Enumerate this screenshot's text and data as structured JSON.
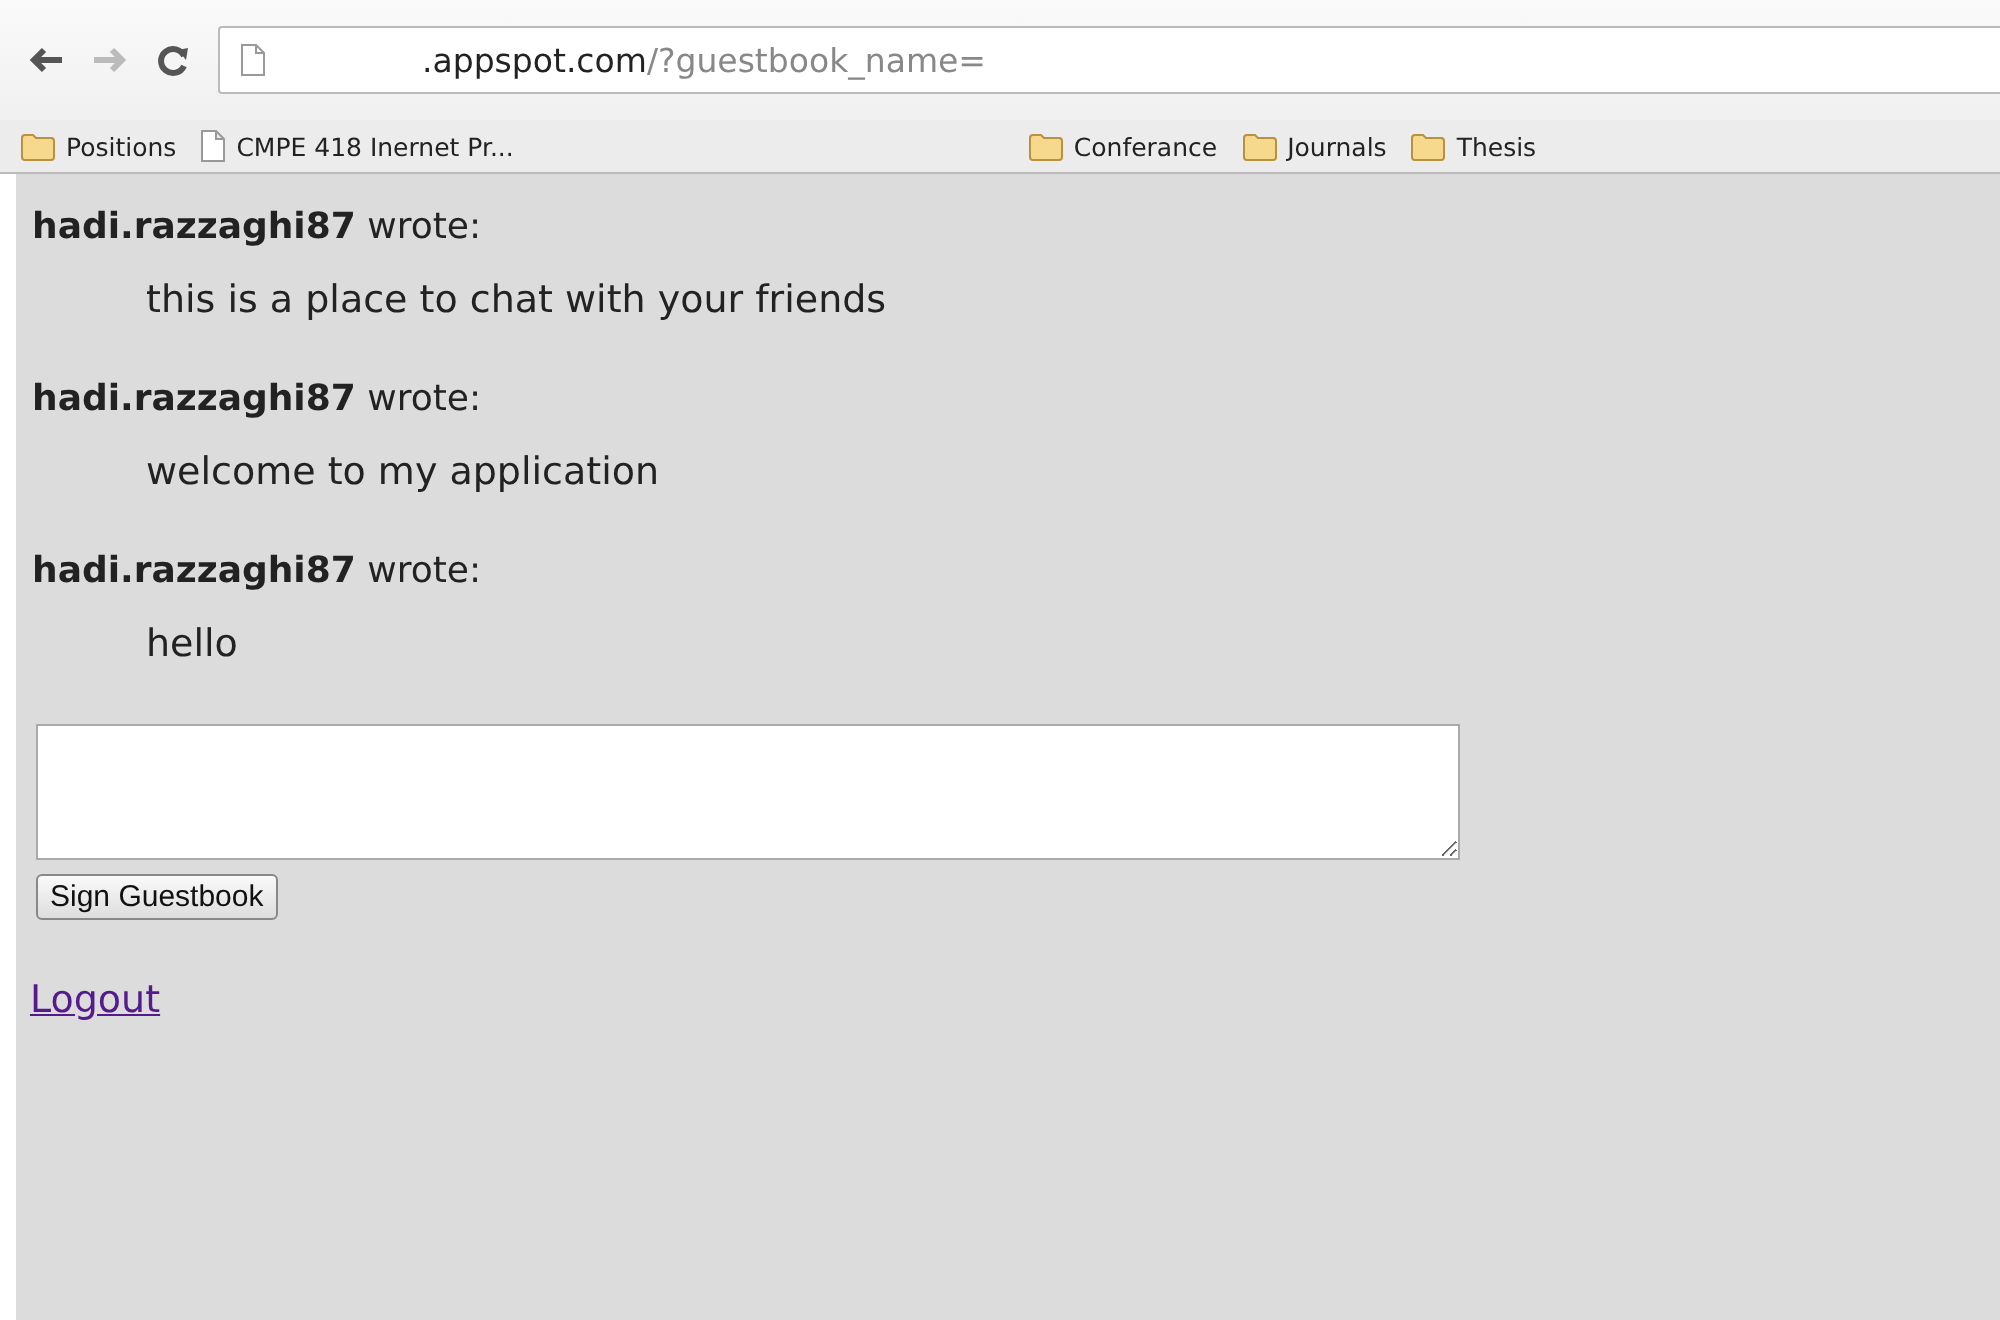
{
  "address_bar": {
    "host": ".appspot.com",
    "path": "/?guestbook_name="
  },
  "bookmarks": [
    {
      "kind": "folder",
      "label": "Positions"
    },
    {
      "kind": "page",
      "label": "CMPE 418 Inernet Pr..."
    },
    {
      "kind": "folder",
      "label": "Conferance"
    },
    {
      "kind": "folder",
      "label": "Journals"
    },
    {
      "kind": "folder",
      "label": "Thesis"
    }
  ],
  "posts": [
    {
      "author_line": "**hadi.razzaghi87** wrote:",
      "message": "this is a place to chat with your friends"
    },
    {
      "author_line": "**hadi.razzaghi87** wrote:",
      "message": "welcome to my application"
    },
    {
      "author_line": "**hadi.razzaghi87** wrote:",
      "message": "hello"
    }
  ],
  "sign_button": "Sign Guestbook",
  "logout_link": "Logout"
}
